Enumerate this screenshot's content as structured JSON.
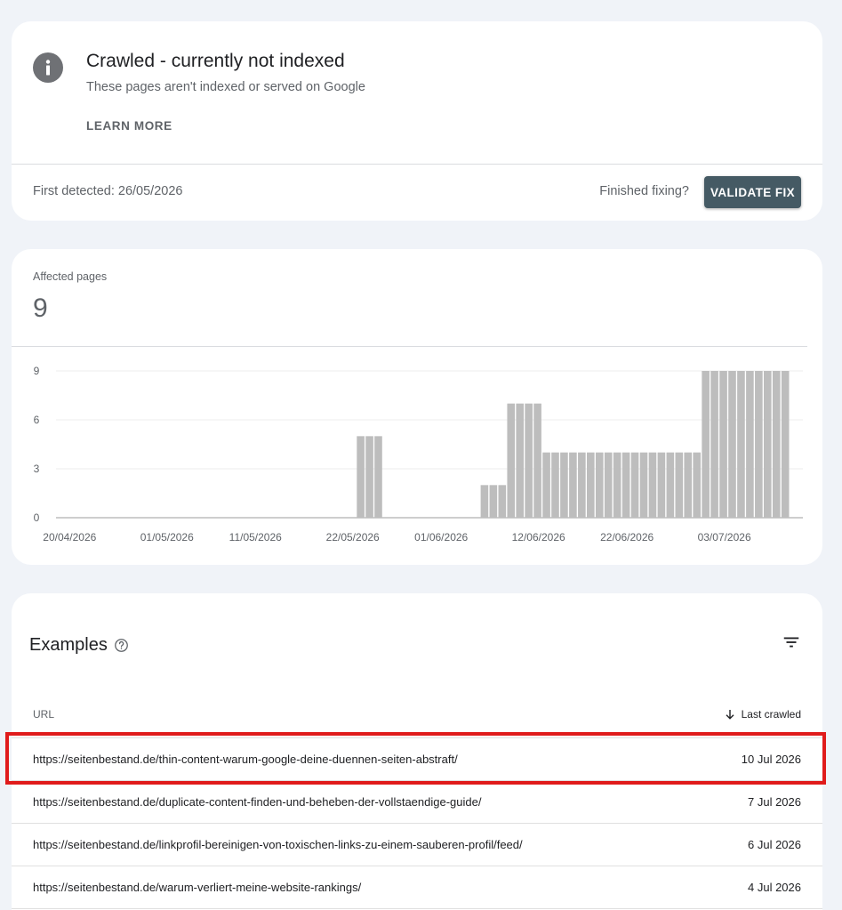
{
  "issue": {
    "title": "Crawled - currently not indexed",
    "subtitle": "These pages aren't indexed or served on Google",
    "learn_more": "LEARN MORE",
    "first_detected": "First detected: 26/05/2026",
    "finished_fixing": "Finished fixing?",
    "validate_fix": "VALIDATE FIX"
  },
  "affected": {
    "label": "Affected pages",
    "value": "9"
  },
  "chart_data": {
    "type": "bar",
    "start_date": "20/04/2026",
    "x_ticks": [
      "20/04/2026",
      "01/05/2026",
      "11/05/2026",
      "22/05/2026",
      "01/06/2026",
      "12/06/2026",
      "22/06/2026",
      "03/07/2026"
    ],
    "y_ticks": [
      0,
      3,
      6,
      9
    ],
    "ylim": [
      0,
      9
    ],
    "values": [
      0,
      0,
      0,
      0,
      0,
      0,
      0,
      0,
      0,
      0,
      0,
      0,
      0,
      0,
      0,
      0,
      0,
      0,
      0,
      0,
      0,
      0,
      0,
      0,
      0,
      0,
      0,
      0,
      0,
      0,
      0,
      0,
      0,
      0,
      5,
      5,
      5,
      0,
      0,
      0,
      0,
      0,
      0,
      0,
      0,
      0,
      0,
      0,
      2,
      2,
      2,
      7,
      7,
      7,
      7,
      4,
      4,
      4,
      4,
      4,
      4,
      4,
      4,
      4,
      4,
      4,
      4,
      4,
      4,
      4,
      4,
      4,
      4,
      9,
      9,
      9,
      9,
      9,
      9,
      9,
      9,
      9,
      9
    ],
    "bar_color": "#bdbdbd",
    "grid": true
  },
  "examples": {
    "title": "Examples",
    "col_url": "URL",
    "col_last_crawled": "Last crawled",
    "rows": [
      {
        "url": "https://seitenbestand.de/thin-content-warum-google-deine-duennen-seiten-abstraft/",
        "date": "10 Jul 2026"
      },
      {
        "url": "https://seitenbestand.de/duplicate-content-finden-und-beheben-der-vollstaendige-guide/",
        "date": "7 Jul 2026"
      },
      {
        "url": "https://seitenbestand.de/linkprofil-bereinigen-von-toxischen-links-zu-einem-sauberen-profil/feed/",
        "date": "6 Jul 2026"
      },
      {
        "url": "https://seitenbestand.de/warum-verliert-meine-website-rankings/",
        "date": "4 Jul 2026"
      }
    ]
  },
  "colors": {
    "accent_button": "#455a64",
    "highlight": "#e01b1b"
  }
}
